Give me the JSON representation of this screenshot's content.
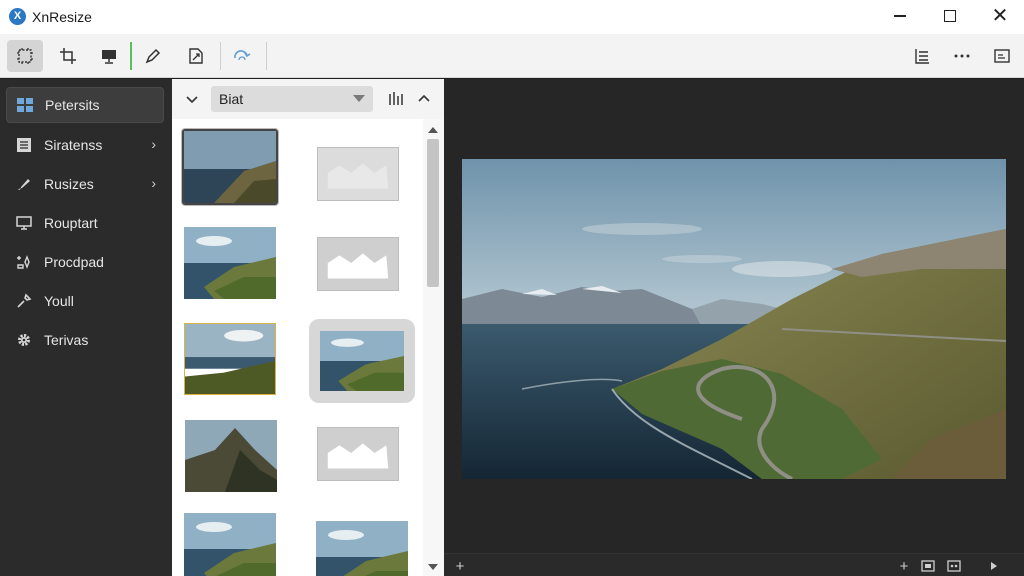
{
  "window": {
    "title": "XnResize",
    "logo_glyph": "X"
  },
  "toolbar": {
    "buttons": [
      {
        "icon": "select-frame-icon"
      },
      {
        "icon": "crop-icon"
      },
      {
        "icon": "monitor-icon"
      },
      {
        "icon": "pen-icon"
      },
      {
        "icon": "resize-icon"
      },
      {
        "icon": "redo-icon"
      }
    ],
    "right_buttons": [
      {
        "icon": "list-icon"
      },
      {
        "icon": "more-icon"
      },
      {
        "icon": "export-icon"
      }
    ]
  },
  "sidebar": {
    "items": [
      {
        "label": "Petersits",
        "icon": "grid-icon",
        "selected": true,
        "chevron": false
      },
      {
        "label": "Siratenss",
        "icon": "document-icon",
        "selected": false,
        "chevron": true
      },
      {
        "label": "Rusizes",
        "icon": "brush-icon",
        "selected": false,
        "chevron": true
      },
      {
        "label": "Rouptart",
        "icon": "monitor-icon",
        "selected": false,
        "chevron": false
      },
      {
        "label": "Procdpad",
        "icon": "sparkle-icon",
        "selected": false,
        "chevron": false
      },
      {
        "label": "Youll",
        "icon": "tools-icon",
        "selected": false,
        "chevron": false
      },
      {
        "label": "Terivas",
        "icon": "gear-icon",
        "selected": false,
        "chevron": false
      }
    ]
  },
  "thumbs": {
    "sort_value": "Biat",
    "items": [
      {
        "kind": "photo",
        "scene": "cliff",
        "selected": true
      },
      {
        "kind": "placeholder",
        "faded": true
      },
      {
        "kind": "photo",
        "scene": "coast"
      },
      {
        "kind": "placeholder"
      },
      {
        "kind": "photo",
        "scene": "hill",
        "gold": true
      },
      {
        "kind": "photo",
        "scene": "coast",
        "card": true
      },
      {
        "kind": "photo",
        "scene": "mountain"
      },
      {
        "kind": "placeholder"
      },
      {
        "kind": "photo",
        "scene": "coast"
      },
      {
        "kind": "photo",
        "scene": "coast"
      }
    ]
  },
  "colors": {
    "accent": "#2b78c5",
    "sidebar_bg": "#2b2b2b",
    "viewer_bg": "#262626"
  }
}
